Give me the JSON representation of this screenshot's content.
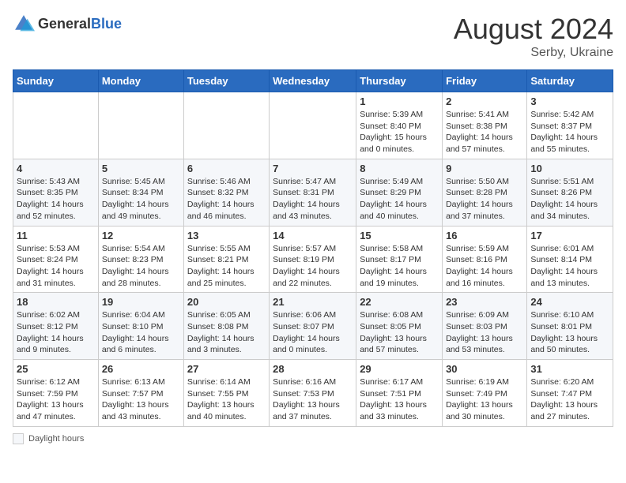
{
  "header": {
    "logo": {
      "text_general": "General",
      "text_blue": "Blue"
    },
    "month_year": "August 2024",
    "location": "Serby, Ukraine"
  },
  "weekdays": [
    "Sunday",
    "Monday",
    "Tuesday",
    "Wednesday",
    "Thursday",
    "Friday",
    "Saturday"
  ],
  "weeks": [
    [
      {
        "day": "",
        "info": ""
      },
      {
        "day": "",
        "info": ""
      },
      {
        "day": "",
        "info": ""
      },
      {
        "day": "",
        "info": ""
      },
      {
        "day": "1",
        "info": "Sunrise: 5:39 AM\nSunset: 8:40 PM\nDaylight: 15 hours and 0 minutes."
      },
      {
        "day": "2",
        "info": "Sunrise: 5:41 AM\nSunset: 8:38 PM\nDaylight: 14 hours and 57 minutes."
      },
      {
        "day": "3",
        "info": "Sunrise: 5:42 AM\nSunset: 8:37 PM\nDaylight: 14 hours and 55 minutes."
      }
    ],
    [
      {
        "day": "4",
        "info": "Sunrise: 5:43 AM\nSunset: 8:35 PM\nDaylight: 14 hours and 52 minutes."
      },
      {
        "day": "5",
        "info": "Sunrise: 5:45 AM\nSunset: 8:34 PM\nDaylight: 14 hours and 49 minutes."
      },
      {
        "day": "6",
        "info": "Sunrise: 5:46 AM\nSunset: 8:32 PM\nDaylight: 14 hours and 46 minutes."
      },
      {
        "day": "7",
        "info": "Sunrise: 5:47 AM\nSunset: 8:31 PM\nDaylight: 14 hours and 43 minutes."
      },
      {
        "day": "8",
        "info": "Sunrise: 5:49 AM\nSunset: 8:29 PM\nDaylight: 14 hours and 40 minutes."
      },
      {
        "day": "9",
        "info": "Sunrise: 5:50 AM\nSunset: 8:28 PM\nDaylight: 14 hours and 37 minutes."
      },
      {
        "day": "10",
        "info": "Sunrise: 5:51 AM\nSunset: 8:26 PM\nDaylight: 14 hours and 34 minutes."
      }
    ],
    [
      {
        "day": "11",
        "info": "Sunrise: 5:53 AM\nSunset: 8:24 PM\nDaylight: 14 hours and 31 minutes."
      },
      {
        "day": "12",
        "info": "Sunrise: 5:54 AM\nSunset: 8:23 PM\nDaylight: 14 hours and 28 minutes."
      },
      {
        "day": "13",
        "info": "Sunrise: 5:55 AM\nSunset: 8:21 PM\nDaylight: 14 hours and 25 minutes."
      },
      {
        "day": "14",
        "info": "Sunrise: 5:57 AM\nSunset: 8:19 PM\nDaylight: 14 hours and 22 minutes."
      },
      {
        "day": "15",
        "info": "Sunrise: 5:58 AM\nSunset: 8:17 PM\nDaylight: 14 hours and 19 minutes."
      },
      {
        "day": "16",
        "info": "Sunrise: 5:59 AM\nSunset: 8:16 PM\nDaylight: 14 hours and 16 minutes."
      },
      {
        "day": "17",
        "info": "Sunrise: 6:01 AM\nSunset: 8:14 PM\nDaylight: 14 hours and 13 minutes."
      }
    ],
    [
      {
        "day": "18",
        "info": "Sunrise: 6:02 AM\nSunset: 8:12 PM\nDaylight: 14 hours and 9 minutes."
      },
      {
        "day": "19",
        "info": "Sunrise: 6:04 AM\nSunset: 8:10 PM\nDaylight: 14 hours and 6 minutes."
      },
      {
        "day": "20",
        "info": "Sunrise: 6:05 AM\nSunset: 8:08 PM\nDaylight: 14 hours and 3 minutes."
      },
      {
        "day": "21",
        "info": "Sunrise: 6:06 AM\nSunset: 8:07 PM\nDaylight: 14 hours and 0 minutes."
      },
      {
        "day": "22",
        "info": "Sunrise: 6:08 AM\nSunset: 8:05 PM\nDaylight: 13 hours and 57 minutes."
      },
      {
        "day": "23",
        "info": "Sunrise: 6:09 AM\nSunset: 8:03 PM\nDaylight: 13 hours and 53 minutes."
      },
      {
        "day": "24",
        "info": "Sunrise: 6:10 AM\nSunset: 8:01 PM\nDaylight: 13 hours and 50 minutes."
      }
    ],
    [
      {
        "day": "25",
        "info": "Sunrise: 6:12 AM\nSunset: 7:59 PM\nDaylight: 13 hours and 47 minutes."
      },
      {
        "day": "26",
        "info": "Sunrise: 6:13 AM\nSunset: 7:57 PM\nDaylight: 13 hours and 43 minutes."
      },
      {
        "day": "27",
        "info": "Sunrise: 6:14 AM\nSunset: 7:55 PM\nDaylight: 13 hours and 40 minutes."
      },
      {
        "day": "28",
        "info": "Sunrise: 6:16 AM\nSunset: 7:53 PM\nDaylight: 13 hours and 37 minutes."
      },
      {
        "day": "29",
        "info": "Sunrise: 6:17 AM\nSunset: 7:51 PM\nDaylight: 13 hours and 33 minutes."
      },
      {
        "day": "30",
        "info": "Sunrise: 6:19 AM\nSunset: 7:49 PM\nDaylight: 13 hours and 30 minutes."
      },
      {
        "day": "31",
        "info": "Sunrise: 6:20 AM\nSunset: 7:47 PM\nDaylight: 13 hours and 27 minutes."
      }
    ]
  ],
  "legend": {
    "label": "Daylight hours"
  }
}
